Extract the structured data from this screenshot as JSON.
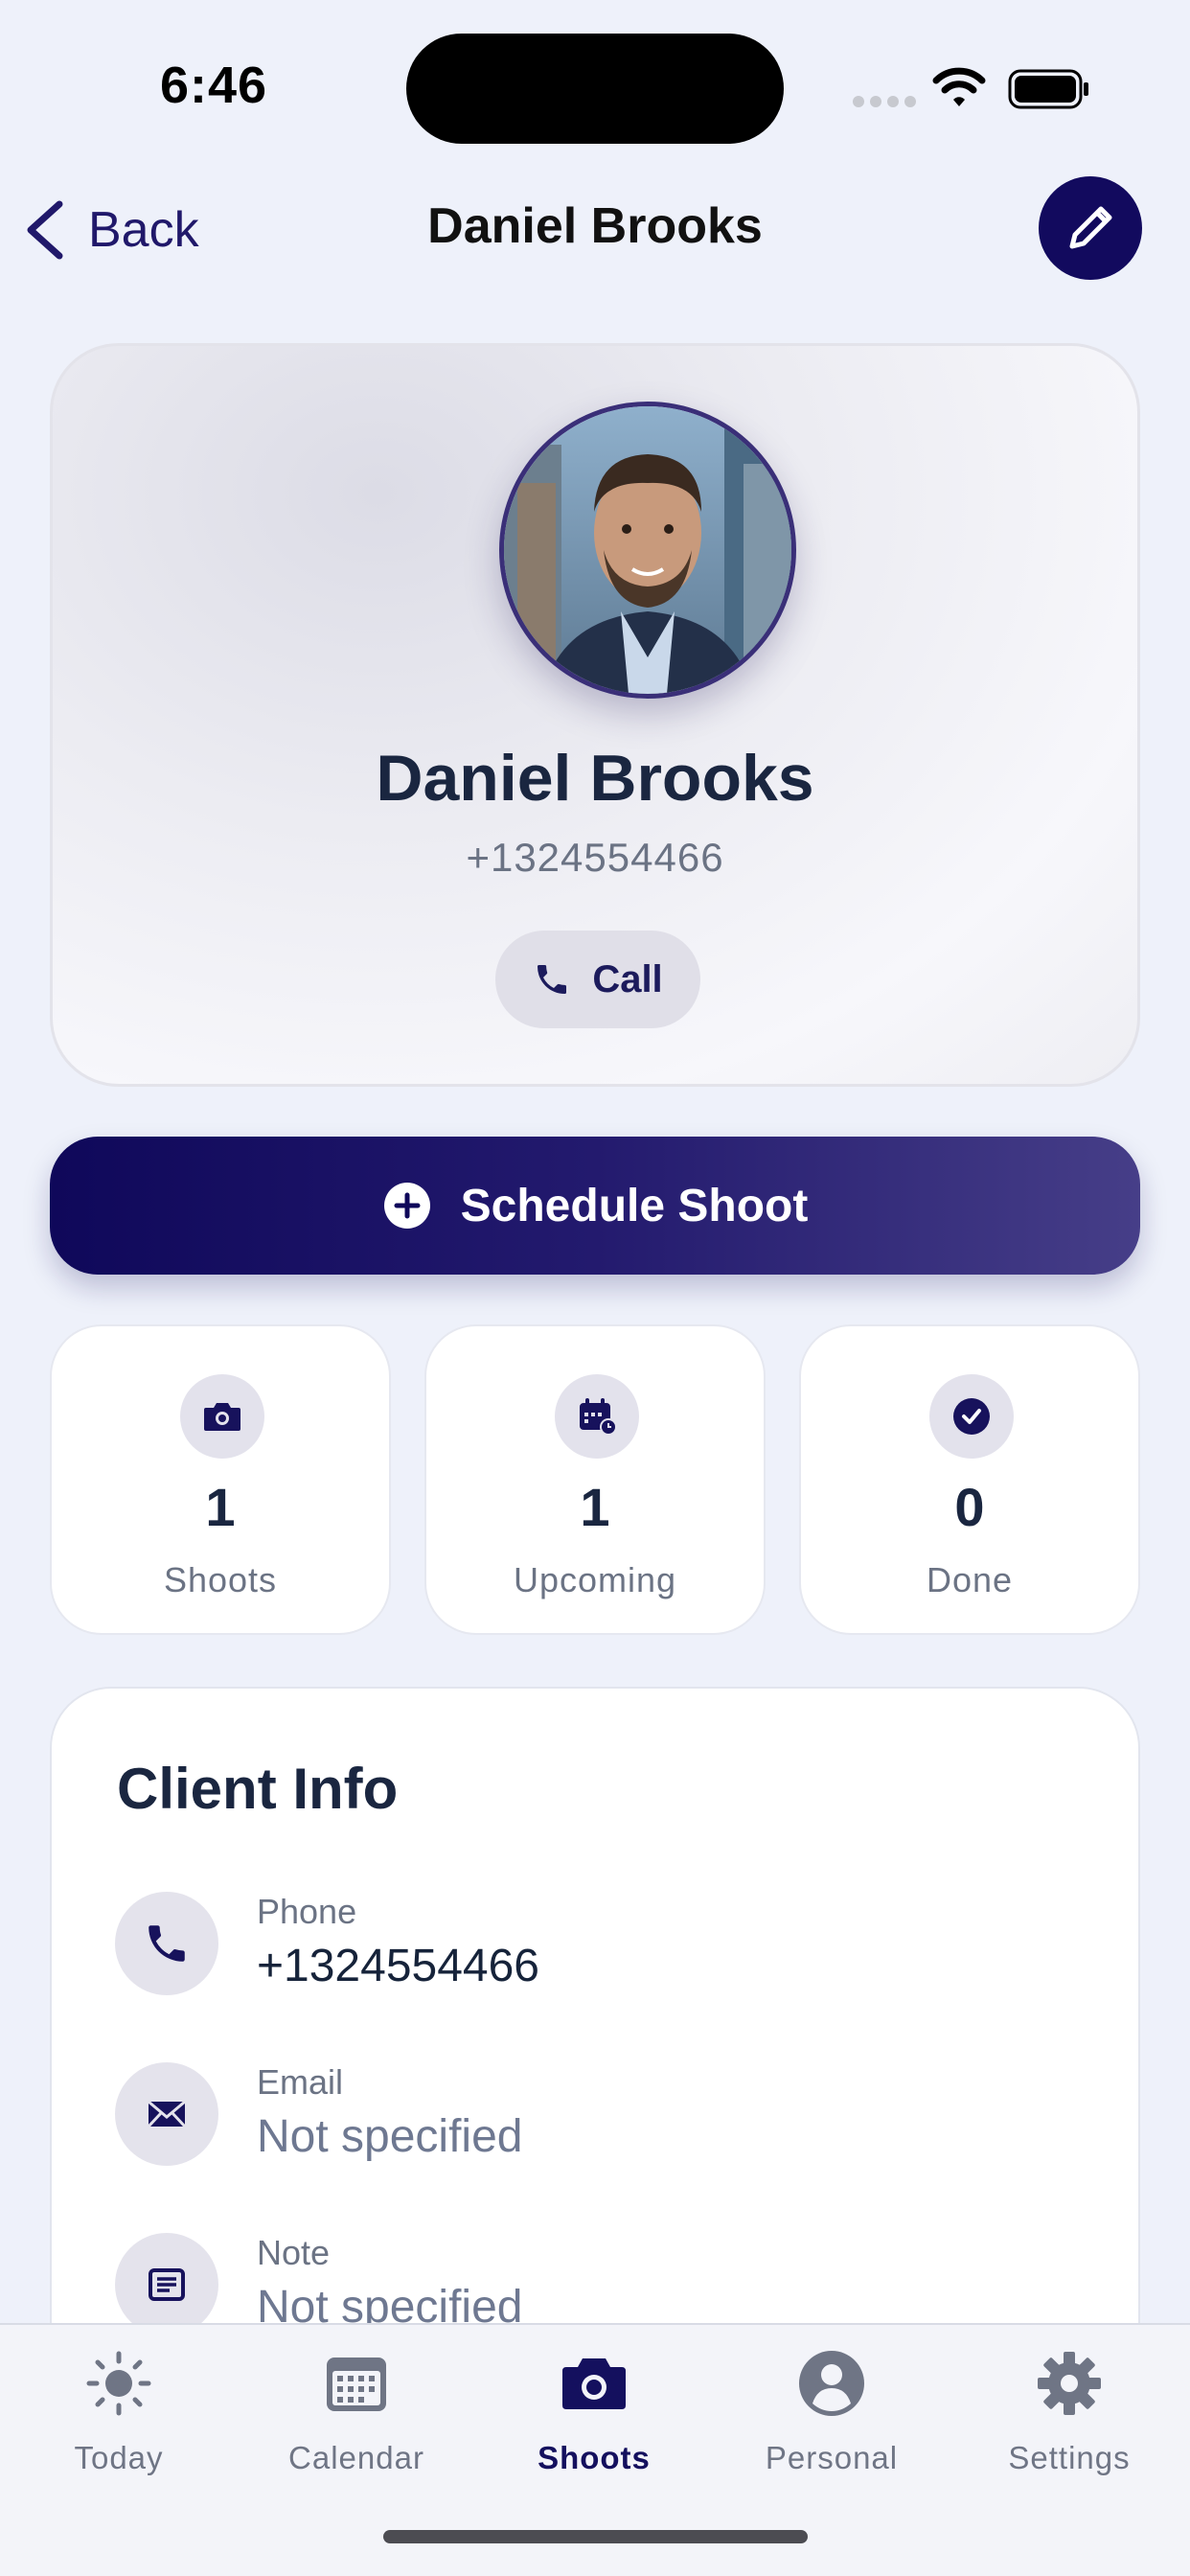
{
  "status_bar": {
    "time": "6:46"
  },
  "nav": {
    "back_label": "Back",
    "title": "Daniel Brooks"
  },
  "profile": {
    "name": "Daniel Brooks",
    "phone": "+1324554466",
    "call_label": "Call"
  },
  "schedule_button": {
    "label": "Schedule Shoot"
  },
  "stats": [
    {
      "icon": "camera-icon",
      "value": "1",
      "label": "Shoots"
    },
    {
      "icon": "calendar-clock-icon",
      "value": "1",
      "label": "Upcoming"
    },
    {
      "icon": "checkmark-circle-icon",
      "value": "0",
      "label": "Done"
    }
  ],
  "client_info": {
    "title": "Client Info",
    "rows": [
      {
        "icon": "phone-icon",
        "label": "Phone",
        "value": "+1324554466"
      },
      {
        "icon": "envelope-icon",
        "label": "Email",
        "value": "Not specified"
      },
      {
        "icon": "note-icon",
        "label": "Note",
        "value": "Not specified"
      }
    ]
  },
  "tab_bar": {
    "active": "Shoots",
    "items": [
      {
        "icon": "sun-icon",
        "label": "Today"
      },
      {
        "icon": "calendar-icon",
        "label": "Calendar"
      },
      {
        "icon": "camera-icon",
        "label": "Shoots"
      },
      {
        "icon": "person-icon",
        "label": "Personal"
      },
      {
        "icon": "gear-icon",
        "label": "Settings"
      }
    ]
  },
  "colors": {
    "accent": "#120a5e",
    "background": "#eef1fa",
    "muted_text": "#6b7384",
    "tab_inactive": "#6f7585"
  }
}
